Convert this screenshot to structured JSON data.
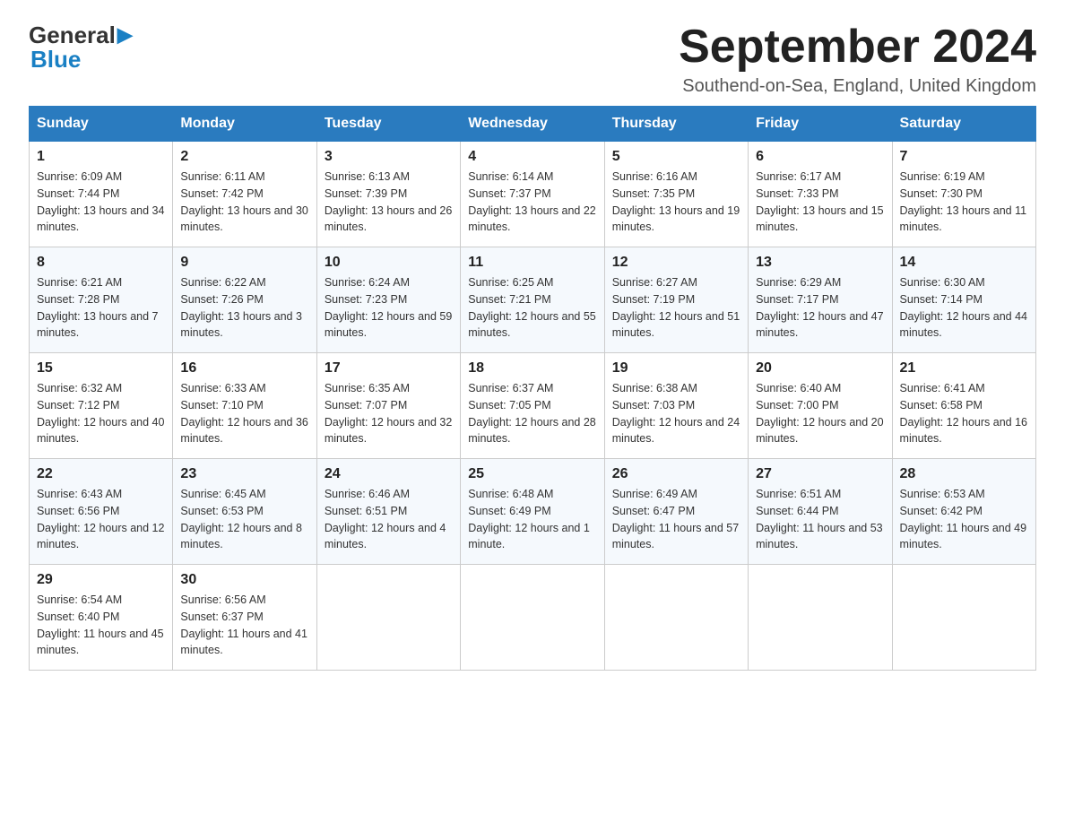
{
  "logo": {
    "name_part1": "General",
    "name_part2": "Blue"
  },
  "header": {
    "month_year": "September 2024",
    "location": "Southend-on-Sea, England, United Kingdom"
  },
  "weekdays": [
    "Sunday",
    "Monday",
    "Tuesday",
    "Wednesday",
    "Thursday",
    "Friday",
    "Saturday"
  ],
  "weeks": [
    [
      {
        "day": "1",
        "sunrise": "6:09 AM",
        "sunset": "7:44 PM",
        "daylight": "13 hours and 34 minutes."
      },
      {
        "day": "2",
        "sunrise": "6:11 AM",
        "sunset": "7:42 PM",
        "daylight": "13 hours and 30 minutes."
      },
      {
        "day": "3",
        "sunrise": "6:13 AM",
        "sunset": "7:39 PM",
        "daylight": "13 hours and 26 minutes."
      },
      {
        "day": "4",
        "sunrise": "6:14 AM",
        "sunset": "7:37 PM",
        "daylight": "13 hours and 22 minutes."
      },
      {
        "day": "5",
        "sunrise": "6:16 AM",
        "sunset": "7:35 PM",
        "daylight": "13 hours and 19 minutes."
      },
      {
        "day": "6",
        "sunrise": "6:17 AM",
        "sunset": "7:33 PM",
        "daylight": "13 hours and 15 minutes."
      },
      {
        "day": "7",
        "sunrise": "6:19 AM",
        "sunset": "7:30 PM",
        "daylight": "13 hours and 11 minutes."
      }
    ],
    [
      {
        "day": "8",
        "sunrise": "6:21 AM",
        "sunset": "7:28 PM",
        "daylight": "13 hours and 7 minutes."
      },
      {
        "day": "9",
        "sunrise": "6:22 AM",
        "sunset": "7:26 PM",
        "daylight": "13 hours and 3 minutes."
      },
      {
        "day": "10",
        "sunrise": "6:24 AM",
        "sunset": "7:23 PM",
        "daylight": "12 hours and 59 minutes."
      },
      {
        "day": "11",
        "sunrise": "6:25 AM",
        "sunset": "7:21 PM",
        "daylight": "12 hours and 55 minutes."
      },
      {
        "day": "12",
        "sunrise": "6:27 AM",
        "sunset": "7:19 PM",
        "daylight": "12 hours and 51 minutes."
      },
      {
        "day": "13",
        "sunrise": "6:29 AM",
        "sunset": "7:17 PM",
        "daylight": "12 hours and 47 minutes."
      },
      {
        "day": "14",
        "sunrise": "6:30 AM",
        "sunset": "7:14 PM",
        "daylight": "12 hours and 44 minutes."
      }
    ],
    [
      {
        "day": "15",
        "sunrise": "6:32 AM",
        "sunset": "7:12 PM",
        "daylight": "12 hours and 40 minutes."
      },
      {
        "day": "16",
        "sunrise": "6:33 AM",
        "sunset": "7:10 PM",
        "daylight": "12 hours and 36 minutes."
      },
      {
        "day": "17",
        "sunrise": "6:35 AM",
        "sunset": "7:07 PM",
        "daylight": "12 hours and 32 minutes."
      },
      {
        "day": "18",
        "sunrise": "6:37 AM",
        "sunset": "7:05 PM",
        "daylight": "12 hours and 28 minutes."
      },
      {
        "day": "19",
        "sunrise": "6:38 AM",
        "sunset": "7:03 PM",
        "daylight": "12 hours and 24 minutes."
      },
      {
        "day": "20",
        "sunrise": "6:40 AM",
        "sunset": "7:00 PM",
        "daylight": "12 hours and 20 minutes."
      },
      {
        "day": "21",
        "sunrise": "6:41 AM",
        "sunset": "6:58 PM",
        "daylight": "12 hours and 16 minutes."
      }
    ],
    [
      {
        "day": "22",
        "sunrise": "6:43 AM",
        "sunset": "6:56 PM",
        "daylight": "12 hours and 12 minutes."
      },
      {
        "day": "23",
        "sunrise": "6:45 AM",
        "sunset": "6:53 PM",
        "daylight": "12 hours and 8 minutes."
      },
      {
        "day": "24",
        "sunrise": "6:46 AM",
        "sunset": "6:51 PM",
        "daylight": "12 hours and 4 minutes."
      },
      {
        "day": "25",
        "sunrise": "6:48 AM",
        "sunset": "6:49 PM",
        "daylight": "12 hours and 1 minute."
      },
      {
        "day": "26",
        "sunrise": "6:49 AM",
        "sunset": "6:47 PM",
        "daylight": "11 hours and 57 minutes."
      },
      {
        "day": "27",
        "sunrise": "6:51 AM",
        "sunset": "6:44 PM",
        "daylight": "11 hours and 53 minutes."
      },
      {
        "day": "28",
        "sunrise": "6:53 AM",
        "sunset": "6:42 PM",
        "daylight": "11 hours and 49 minutes."
      }
    ],
    [
      {
        "day": "29",
        "sunrise": "6:54 AM",
        "sunset": "6:40 PM",
        "daylight": "11 hours and 45 minutes."
      },
      {
        "day": "30",
        "sunrise": "6:56 AM",
        "sunset": "6:37 PM",
        "daylight": "11 hours and 41 minutes."
      },
      null,
      null,
      null,
      null,
      null
    ]
  ],
  "labels": {
    "sunrise": "Sunrise:",
    "sunset": "Sunset:",
    "daylight": "Daylight:"
  }
}
